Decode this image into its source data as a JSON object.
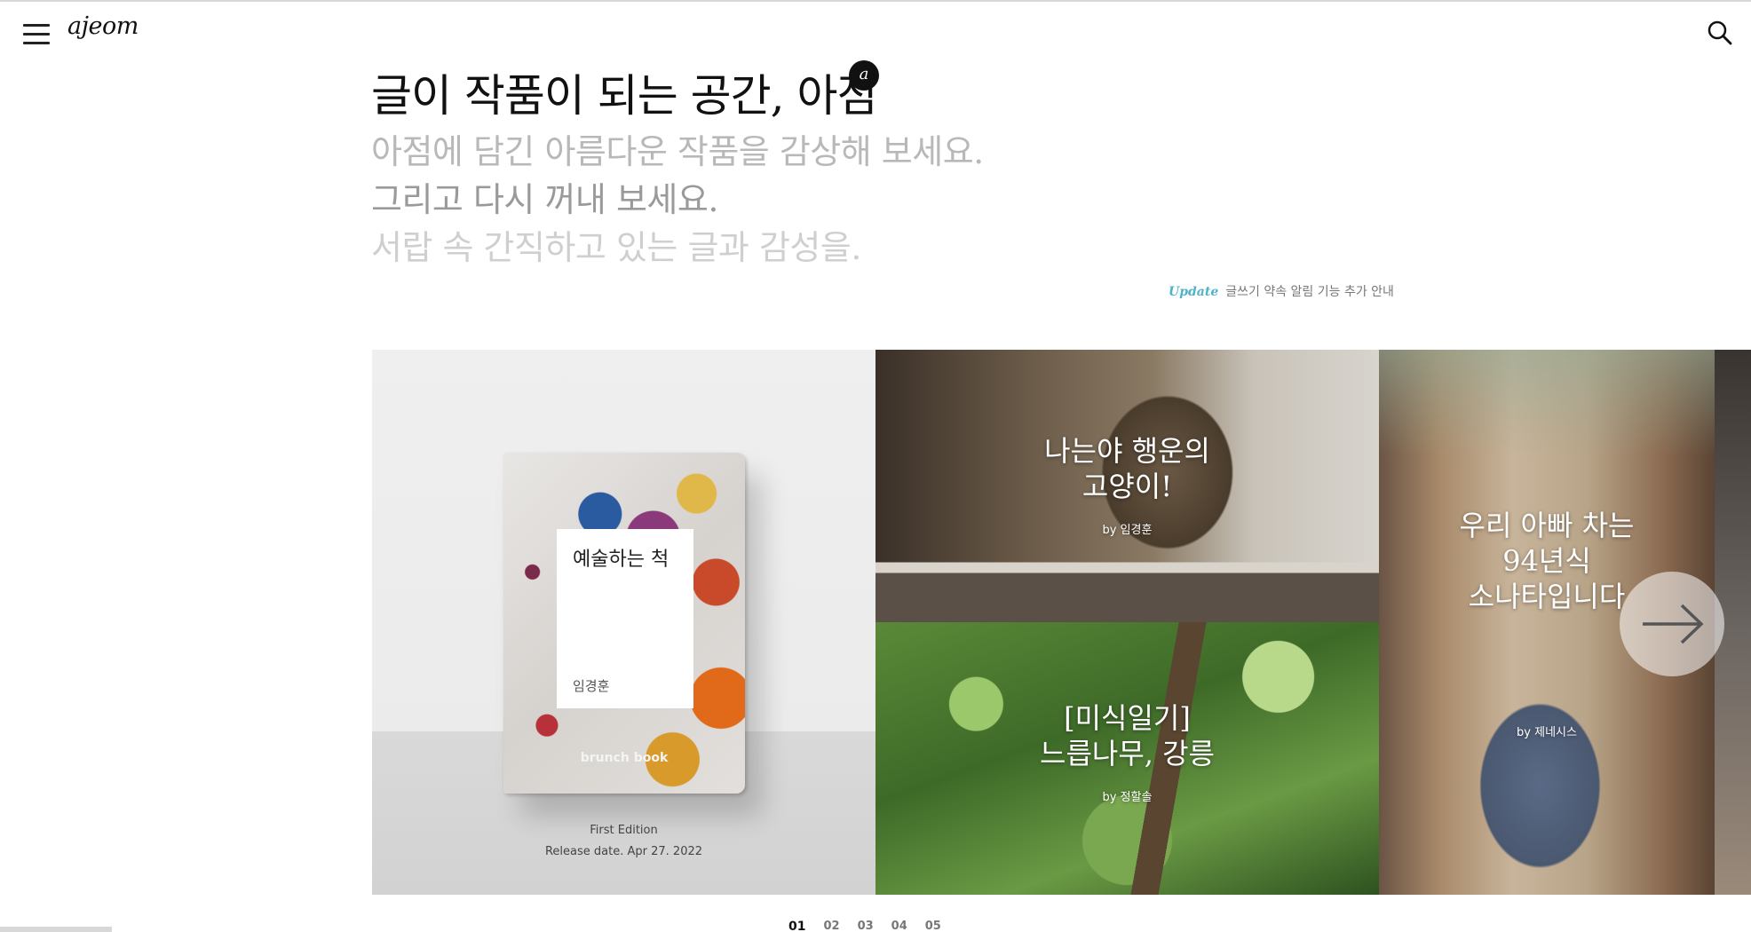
{
  "header": {
    "logo": "ajeom",
    "menu_icon": "hamburger-menu-icon",
    "search_icon": "search-icon"
  },
  "hero": {
    "title": "글이 작품이 되는 공간, 아점",
    "badge": "a",
    "line1": "아점에 담긴 아름다운 작품을 감상해 보세요.",
    "line2": "그리고 다시 꺼내 보세요.",
    "line3": "서랍 속 간직하고 있는 글과 감성을."
  },
  "update": {
    "tag": "Update",
    "text": "글쓰기 약속 알림 기능 추가 안내"
  },
  "slides": {
    "book": {
      "title": "예술하는 척",
      "author": "임경훈",
      "brand": "brunch book",
      "edition": "First Edition",
      "release": "Release date. Apr 27. 2022"
    },
    "cat": {
      "title": "나는야 행운의\n고양이!",
      "by": "by 임경훈"
    },
    "tree": {
      "title": "[미식일기]\n느릅나무, 강릉",
      "by": "by 정할솔"
    },
    "street": {
      "title": "우리 아빠 차는\n94년식\n소나타입니다",
      "by": "by 제네시스"
    }
  },
  "pagination": {
    "pages": [
      "01",
      "02",
      "03",
      "04",
      "05"
    ],
    "active_index": 0
  },
  "colors": {
    "update_tag": "#4fb3c8",
    "text_primary": "#111111",
    "text_faint": "#b8b8b8"
  }
}
